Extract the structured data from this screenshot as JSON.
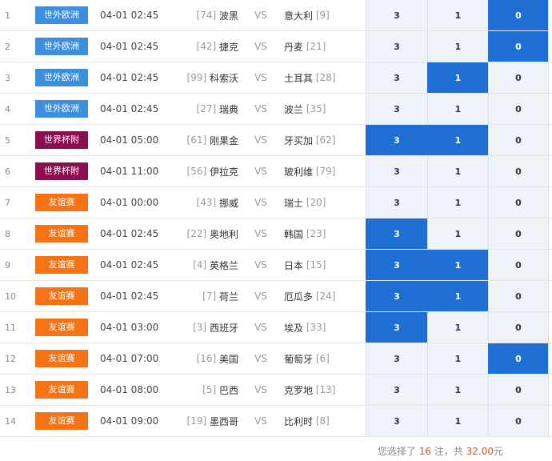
{
  "colors": {
    "world_europe": "#3e8ede",
    "world_cup_qualifier": "#8b0e4f",
    "friendly": "#f57314",
    "selected": "#1f6ed4",
    "option_bg": "#edf3f9",
    "highlight": "#f04a16"
  },
  "vs_label": "VS",
  "matches": [
    {
      "num": "1",
      "league": "世外欧洲",
      "league_type": "world_europe",
      "time": "04-01 02:45",
      "home_rank": "[74]",
      "home": "波黑",
      "away": "意大利",
      "away_rank": "[9]",
      "opts": [
        "3",
        "1",
        "0"
      ],
      "sel": [
        false,
        false,
        true
      ]
    },
    {
      "num": "2",
      "league": "世外欧洲",
      "league_type": "world_europe",
      "time": "04-01 02:45",
      "home_rank": "[42]",
      "home": "捷克",
      "away": "丹麦",
      "away_rank": "[21]",
      "opts": [
        "3",
        "1",
        "0"
      ],
      "sel": [
        false,
        false,
        true
      ]
    },
    {
      "num": "3",
      "league": "世外欧洲",
      "league_type": "world_europe",
      "time": "04-01 02:45",
      "home_rank": "[99]",
      "home": "科索沃",
      "away": "土耳其",
      "away_rank": "[28]",
      "opts": [
        "3",
        "1",
        "0"
      ],
      "sel": [
        false,
        true,
        false
      ]
    },
    {
      "num": "4",
      "league": "世外欧洲",
      "league_type": "world_europe",
      "time": "04-01 02:45",
      "home_rank": "[27]",
      "home": "瑞典",
      "away": "波兰",
      "away_rank": "[35]",
      "opts": [
        "3",
        "1",
        "0"
      ],
      "sel": [
        false,
        false,
        false
      ]
    },
    {
      "num": "5",
      "league": "世界杯附",
      "league_type": "world_cup_qualifier",
      "time": "04-01 05:00",
      "home_rank": "[61]",
      "home": "刚果金",
      "away": "牙买加",
      "away_rank": "[62]",
      "opts": [
        "3",
        "1",
        "0"
      ],
      "sel": [
        true,
        true,
        false
      ]
    },
    {
      "num": "6",
      "league": "世界杯附",
      "league_type": "world_cup_qualifier",
      "time": "04-01 11:00",
      "home_rank": "[56]",
      "home": "伊拉克",
      "away": "玻利维",
      "away_rank": "[79]",
      "opts": [
        "3",
        "1",
        "0"
      ],
      "sel": [
        false,
        false,
        false
      ]
    },
    {
      "num": "7",
      "league": "友谊赛",
      "league_type": "friendly",
      "time": "04-01 00:00",
      "home_rank": "[43]",
      "home": "挪威",
      "away": "瑞士",
      "away_rank": "[20]",
      "opts": [
        "3",
        "1",
        "0"
      ],
      "sel": [
        false,
        false,
        false
      ]
    },
    {
      "num": "8",
      "league": "友谊赛",
      "league_type": "friendly",
      "time": "04-01 02:45",
      "home_rank": "[22]",
      "home": "奥地利",
      "away": "韩国",
      "away_rank": "[23]",
      "opts": [
        "3",
        "1",
        "0"
      ],
      "sel": [
        true,
        false,
        false
      ]
    },
    {
      "num": "9",
      "league": "友谊赛",
      "league_type": "friendly",
      "time": "04-01 02:45",
      "home_rank": "[4]",
      "home": "英格兰",
      "away": "日本",
      "away_rank": "[15]",
      "opts": [
        "3",
        "1",
        "0"
      ],
      "sel": [
        true,
        true,
        false
      ]
    },
    {
      "num": "10",
      "league": "友谊赛",
      "league_type": "friendly",
      "time": "04-01 02:45",
      "home_rank": "[7]",
      "home": "荷兰",
      "away": "厄瓜多",
      "away_rank": "[24]",
      "opts": [
        "3",
        "1",
        "0"
      ],
      "sel": [
        true,
        true,
        false
      ]
    },
    {
      "num": "11",
      "league": "友谊赛",
      "league_type": "friendly",
      "time": "04-01 03:00",
      "home_rank": "[3]",
      "home": "西班牙",
      "away": "埃及",
      "away_rank": "[33]",
      "opts": [
        "3",
        "1",
        "0"
      ],
      "sel": [
        true,
        false,
        false
      ]
    },
    {
      "num": "12",
      "league": "友谊赛",
      "league_type": "friendly",
      "time": "04-01 07:00",
      "home_rank": "[16]",
      "home": "美国",
      "away": "葡萄牙",
      "away_rank": "[6]",
      "opts": [
        "3",
        "1",
        "0"
      ],
      "sel": [
        false,
        false,
        true
      ]
    },
    {
      "num": "13",
      "league": "友谊赛",
      "league_type": "friendly",
      "time": "04-01 08:00",
      "home_rank": "[5]",
      "home": "巴西",
      "away": "克罗地",
      "away_rank": "[13]",
      "opts": [
        "3",
        "1",
        "0"
      ],
      "sel": [
        false,
        false,
        false
      ]
    },
    {
      "num": "14",
      "league": "友谊赛",
      "league_type": "friendly",
      "time": "04-01 09:00",
      "home_rank": "[19]",
      "home": "墨西哥",
      "away": "比利时",
      "away_rank": "[8]",
      "opts": [
        "3",
        "1",
        "0"
      ],
      "sel": [
        false,
        false,
        false
      ]
    }
  ],
  "summary": {
    "prefix": "您选择了 ",
    "count": "16",
    "middle": " 注，共 ",
    "amount": "32.00",
    "suffix": "元"
  }
}
